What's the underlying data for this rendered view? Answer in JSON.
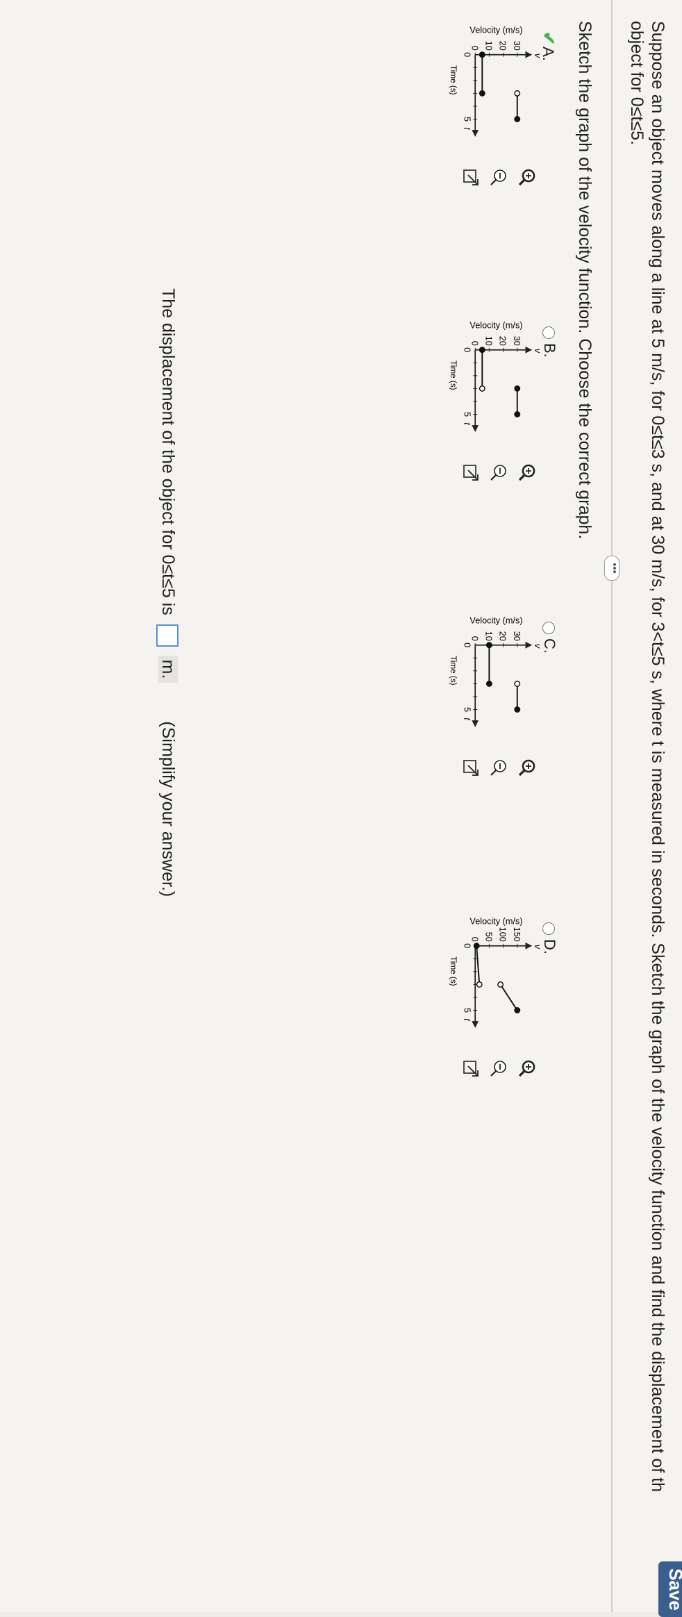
{
  "header": {
    "save_label": "Save"
  },
  "question": {
    "line1": "Suppose an object moves along a line at 5 m/s, for 0≤t≤3 s, and at 30 m/s, for 3<t≤5 s, where t is measured in seconds. Sketch the graph of the velocity function and find the displacement of th",
    "line2": "object for 0≤t≤5.",
    "more_label": "•••"
  },
  "part1": {
    "prompt": "Sketch the graph of the velocity function. Choose the correct graph."
  },
  "options": [
    {
      "label": "A.",
      "selected": true,
      "chart_data": {
        "type": "line",
        "ylabel": "Velocity (m/s)",
        "xlabel": "Time (s)",
        "y_axis_letter": "v",
        "x_axis_letter": "t",
        "y_ticks": [
          "30",
          "20",
          "10",
          "0"
        ],
        "x_ticks": [
          "0",
          "5"
        ],
        "ylim": [
          0,
          30
        ],
        "xlim": [
          0,
          5
        ],
        "segments": [
          {
            "x": [
              0,
              3
            ],
            "y": [
              5,
              5
            ],
            "start": "closed",
            "end": "closed"
          },
          {
            "x": [
              3,
              5
            ],
            "y": [
              30,
              30
            ],
            "start": "open",
            "end": "closed"
          }
        ]
      }
    },
    {
      "label": "B.",
      "selected": false,
      "chart_data": {
        "type": "line",
        "ylabel": "Velocity (m/s)",
        "xlabel": "Time (s)",
        "y_axis_letter": "v",
        "x_axis_letter": "t",
        "y_ticks": [
          "30",
          "20",
          "10",
          "0"
        ],
        "x_ticks": [
          "0",
          "5"
        ],
        "ylim": [
          0,
          30
        ],
        "xlim": [
          0,
          5
        ],
        "segments": [
          {
            "x": [
              0,
              3
            ],
            "y": [
              5,
              5
            ],
            "start": "closed",
            "end": "open"
          },
          {
            "x": [
              3,
              5
            ],
            "y": [
              30,
              30
            ],
            "start": "closed",
            "end": "closed"
          }
        ]
      }
    },
    {
      "label": "C.",
      "selected": false,
      "chart_data": {
        "type": "line",
        "ylabel": "Velocity (m/s)",
        "xlabel": "Time (s)",
        "y_axis_letter": "v",
        "x_axis_letter": "t",
        "y_ticks": [
          "30",
          "20",
          "10",
          "0"
        ],
        "x_ticks": [
          "0",
          "5"
        ],
        "ylim": [
          0,
          30
        ],
        "xlim": [
          0,
          5
        ],
        "segments": [
          {
            "x": [
              0,
              3
            ],
            "y": [
              10,
              10
            ],
            "start": "closed",
            "end": "closed"
          },
          {
            "x": [
              3,
              5
            ],
            "y": [
              30,
              30
            ],
            "start": "open",
            "end": "closed"
          }
        ]
      }
    },
    {
      "label": "D.",
      "selected": false,
      "chart_data": {
        "type": "line",
        "ylabel": "Velocity (m/s)",
        "xlabel": "Time (s)",
        "y_axis_letter": "v",
        "x_axis_letter": "t",
        "y_ticks": [
          "150",
          "100",
          "50",
          "0"
        ],
        "x_ticks": [
          "0",
          "5"
        ],
        "ylim": [
          0,
          150
        ],
        "xlim": [
          0,
          5
        ],
        "segments": [
          {
            "x": [
              0,
              3
            ],
            "y": [
              5,
              15
            ],
            "start": "closed",
            "end": "open"
          },
          {
            "x": [
              3,
              5
            ],
            "y": [
              90,
              150
            ],
            "start": "open",
            "end": "closed"
          }
        ]
      }
    }
  ],
  "tools": {
    "zoom_in_icon": "zoom-in-icon",
    "zoom_out_icon": "zoom-out-icon",
    "popout_icon": "popout-icon"
  },
  "part2": {
    "prefix": "The displacement of the object for 0≤t≤5 is",
    "answer_value": "",
    "unit": "m.",
    "hint": "(Simplify your answer.)"
  },
  "colors": {
    "selected_check": "#4caf50",
    "answer_box_border": "#5a8fd0",
    "save_button": "#3a5f8f"
  }
}
